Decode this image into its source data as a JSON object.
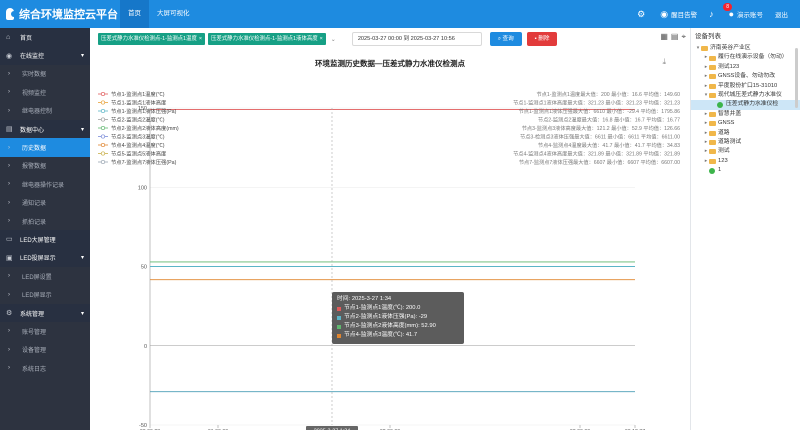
{
  "app": {
    "title": "综合环境监控云平台"
  },
  "topnav": [
    {
      "label": "首页",
      "active": true
    },
    {
      "label": "大屏可视化",
      "active": false
    }
  ],
  "topright": {
    "company": "醒目告警",
    "badge": "8",
    "user": "演示账号",
    "logout": "退出"
  },
  "sidebar": [
    {
      "label": "首页",
      "type": "group",
      "icon": "home-icon",
      "glyph": "⌂"
    },
    {
      "label": "在线监控",
      "type": "group",
      "icon": "monitor-icon",
      "glyph": "◉",
      "caret": "▾"
    },
    {
      "label": "实时数据",
      "type": "sub"
    },
    {
      "label": "视频监控",
      "type": "sub"
    },
    {
      "label": "继电器控制",
      "type": "sub"
    },
    {
      "label": "数据中心",
      "type": "group",
      "icon": "data-center-icon",
      "glyph": "▤",
      "caret": "▾"
    },
    {
      "label": "历史数据",
      "type": "sub",
      "active": true
    },
    {
      "label": "报警数据",
      "type": "sub"
    },
    {
      "label": "继电器操作记录",
      "type": "sub"
    },
    {
      "label": "通知记录",
      "type": "sub"
    },
    {
      "label": "抓拍记录",
      "type": "sub"
    },
    {
      "label": "LED大屏管理",
      "type": "group",
      "icon": "led-screen-icon",
      "glyph": "▭"
    },
    {
      "label": "LED投屏显示",
      "type": "group",
      "icon": "led-display-icon",
      "glyph": "▣",
      "caret": "▾"
    },
    {
      "label": "LED屏设置",
      "type": "sub"
    },
    {
      "label": "LED屏显示",
      "type": "sub"
    },
    {
      "label": "系统管理",
      "type": "group",
      "icon": "system-icon",
      "glyph": "⚙",
      "caret": "▾"
    },
    {
      "label": "账号管理",
      "type": "sub"
    },
    {
      "label": "设备管理",
      "type": "sub"
    },
    {
      "label": "系统日志",
      "type": "sub"
    }
  ],
  "toolbar": {
    "tags": [
      "压差式静力水准仪检测点-1-监测点1温度",
      "压差式静力水准仪检测点-1-监测点1液体高度"
    ],
    "date_range": "2025-03-27 00:00 到 2025-03-27 10:56",
    "query_label": "查询",
    "delete_label": "删除"
  },
  "chart_data": {
    "type": "line",
    "title": "环境监测历史数据—压差式静力水准仪检测点",
    "ylim": [
      -50,
      150
    ],
    "yticks": [
      -50,
      0,
      50,
      100,
      150
    ],
    "xticks": [
      {
        "time": "00:09:28",
        "date": "2025-03-27"
      },
      {
        "time": "01:00:00",
        "date": "2025-03-27"
      },
      {
        "time": "02:00:00",
        "date": "2025-03-27"
      },
      {
        "time": "03:00:00",
        "date": "2025-03-27"
      },
      {
        "time": "00:12:37",
        "date": "2025-03-27"
      }
    ],
    "cursor_label": "2025-3-27 1:34",
    "legend": [
      {
        "name": "节点1-监测点1温度(℃)",
        "color": "#e05a5a"
      },
      {
        "name": "节点1-监测点1液体高度",
        "color": "#e8a23a"
      },
      {
        "name": "节点1-监测点1液体压强(Pa)",
        "color": "#5bb5c7"
      },
      {
        "name": "节点2-监测点2温度(℃)",
        "color": "#a0a0a0"
      },
      {
        "name": "节点2-监测点2液体高度(mm)",
        "color": "#5fb76e"
      },
      {
        "name": "节点3-监测点3温度(℃)",
        "color": "#7b8cd9"
      },
      {
        "name": "节点4-监测点4温度(℃)",
        "color": "#e0852f"
      },
      {
        "name": "节点5-监测点5液体高度",
        "color": "#c9b04a"
      },
      {
        "name": "节点7-监测点7液体压强(Pa)",
        "color": "#9aa6b2"
      }
    ],
    "stats": [
      "节点1-监测点1温度最大值：200 最小值：16.6 平均值：149.60",
      "节点1-监测点1液体高度最大值：321.23 最小值：321.23 平均值：321.23",
      "节点1-监测点1液体压强最大值：6610 最小值：-29.4 平均值：1795.86",
      "节点2-监测点2温度最大值：16.8 最小值：16.7 平均值：16.77",
      "节点3-监测点3液体高度最大值：121.2 最小值：52.9 平均值：126.66",
      "节点3-检测点3液体压强最大值：6611 最小值：6611 平均值：6611.00",
      "节点4-监测点4温度最大值：41.7 最小值：41.7 平均值：34.83",
      "节点4-监测点4液体高度最大值：321.89 最小值：321.89 平均值：321.89",
      "节点7-监测点7液体压强最大值：6607 最小值：6607 平均值：6607.00"
    ],
    "series": [
      {
        "name": "节点1-监测点1温度(℃)",
        "color": "#e05a5a",
        "values": [
          149,
          149
        ]
      },
      {
        "name": "节点2-监测点2液体高度(mm)",
        "color": "#5fb76e",
        "values": [
          52.9,
          52.9
        ]
      },
      {
        "name": "节点1-监测点1液体压强(Pa)",
        "color": "#5bb5c7",
        "values": [
          50,
          50
        ]
      },
      {
        "name": "节点4-监测点4温度(℃)",
        "color": "#e0852f",
        "values": [
          41.7,
          41.7
        ]
      },
      {
        "name": "节点1-监测点1液体压强(Pa)",
        "color": "#4a9db5",
        "values": [
          -29,
          -29
        ]
      }
    ]
  },
  "tooltip": {
    "time": "时间: 2025-3-27 1:34",
    "rows": [
      {
        "text": "节点1-监测点1温度(℃): 200.0",
        "color": "#e05a5a"
      },
      {
        "text": "节点2-监测点1液体压强(Pa): -29",
        "color": "#5bb5c7"
      },
      {
        "text": "节点3-监测点2液体高度(mm): 52.90",
        "color": "#5fb76e"
      },
      {
        "text": "节点4-监测点3温度(℃): 41.7",
        "color": "#e0852f"
      }
    ]
  },
  "device_panel": {
    "title": "设备列表",
    "tree": [
      {
        "label": "济南英谷产业区",
        "level": 0,
        "kind": "folder",
        "toggle": "▾"
      },
      {
        "label": "履行在线演示设备（勿动）",
        "level": 1,
        "kind": "folder",
        "toggle": "▸"
      },
      {
        "label": "测试123",
        "level": 1,
        "kind": "folder",
        "toggle": "▸"
      },
      {
        "label": "GNSS设备、勿动勿改",
        "level": 1,
        "kind": "folder",
        "toggle": "▸"
      },
      {
        "label": "平度股份扩口15-31010",
        "level": 1,
        "kind": "folder",
        "toggle": "▸"
      },
      {
        "label": "现代城压差式静力水准仪",
        "level": 1,
        "kind": "folder",
        "toggle": "▾"
      },
      {
        "label": "压差式静力水准仪检",
        "level": 2,
        "kind": "leaf",
        "selected": true
      },
      {
        "label": "智慧井盖",
        "level": 1,
        "kind": "folder",
        "toggle": "▸"
      },
      {
        "label": "GNSS",
        "level": 1,
        "kind": "folder",
        "toggle": "▸"
      },
      {
        "label": "道路",
        "level": 1,
        "kind": "folder",
        "toggle": "▸"
      },
      {
        "label": "道路测试",
        "level": 1,
        "kind": "folder",
        "toggle": "▸"
      },
      {
        "label": "测试",
        "level": 1,
        "kind": "folder",
        "toggle": "▸"
      },
      {
        "label": "123",
        "level": 1,
        "kind": "folder",
        "toggle": "▸"
      },
      {
        "label": "1",
        "level": 1,
        "kind": "leaf"
      }
    ]
  }
}
